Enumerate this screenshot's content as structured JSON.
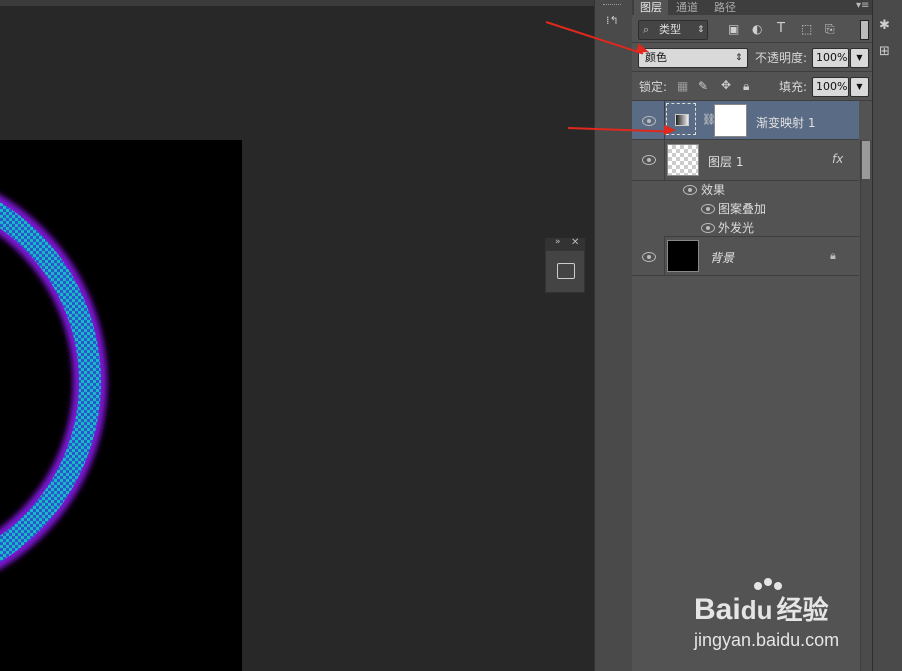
{
  "tabs": [
    "图层",
    "通道",
    "路径"
  ],
  "filter": {
    "label": "类型",
    "search_icon": "search-icon"
  },
  "blend": {
    "mode": "颜色",
    "opacity_label": "不透明度:",
    "opacity_value": "100%"
  },
  "lock": {
    "label": "锁定:",
    "fill_label": "填充:",
    "fill_value": "100%"
  },
  "layers": [
    {
      "name": "渐变映射 1",
      "type": "adjustment",
      "selected": true
    },
    {
      "name": "图层 1",
      "type": "layer",
      "fx": "fx"
    },
    {
      "name": "背景",
      "type": "background",
      "locked": true
    }
  ],
  "effects": {
    "label": "效果",
    "items": [
      "图案叠加",
      "外发光"
    ]
  },
  "watermark": {
    "brand": "Bai",
    "brand_tail": "经验",
    "url": "jingyan.baidu.com"
  },
  "colors": {
    "arrow": "#e0281d",
    "selected_row": "#5a6b85",
    "panel": "#535353",
    "ring_start": "#6f1fd8",
    "ring_mid": "#1fa7c7"
  }
}
